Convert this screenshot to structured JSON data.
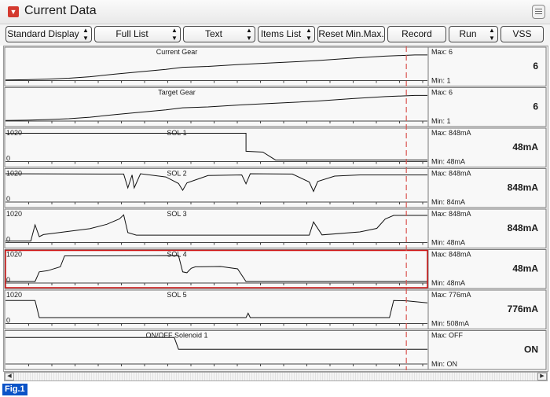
{
  "window": {
    "title": "Current Data"
  },
  "toolbar": {
    "standard_display": "Standard Display",
    "full_list": "Full List",
    "text": "Text",
    "items_list": "Items List",
    "reset_minmax": "Reset Min.Max.",
    "record": "Record",
    "run": "Run",
    "vss": "VSS"
  },
  "graphs": [
    {
      "name": "Current Gear",
      "max": "Max: 6",
      "min": "Min: 1",
      "value": "6",
      "axis_top": "",
      "axis_bottom": ""
    },
    {
      "name": "Target Gear",
      "max": "Max: 6",
      "min": "Min: 1",
      "value": "6",
      "axis_top": "",
      "axis_bottom": ""
    },
    {
      "name": "SOL 1",
      "max": "Max:  848mA",
      "min": "Min:   48mA",
      "value": "48mA",
      "axis_top": "1020",
      "axis_bottom": "0"
    },
    {
      "name": "SOL 2",
      "max": "Max:  848mA",
      "min": "Min:   84mA",
      "value": "848mA",
      "axis_top": "1020",
      "axis_bottom": "0"
    },
    {
      "name": "SOL 3",
      "max": "Max:  848mA",
      "min": "Min:   48mA",
      "value": "848mA",
      "axis_top": "1020",
      "axis_bottom": "0"
    },
    {
      "name": "SOL 4",
      "max": "Max:  848mA",
      "min": "Min:   48mA",
      "value": "48mA",
      "axis_top": "1020",
      "axis_bottom": "0"
    },
    {
      "name": "SOL 5",
      "max": "Max:  776mA",
      "min": "Min:   508mA",
      "value": "776mA",
      "axis_top": "1020",
      "axis_bottom": "0"
    },
    {
      "name": "ON/OFF Solenoid 1",
      "max": "Max: OFF",
      "min": "Min: ON",
      "value": "ON",
      "axis_top": "",
      "axis_bottom": ""
    }
  ],
  "selected_graph": 5,
  "colors": {
    "trace": "#111111",
    "cursor": "#d9534f",
    "selection": "#cc1111",
    "accent": "#d43a2f",
    "fig_badge": "#0a53c7"
  },
  "traces": [
    [
      [
        0,
        0.02
      ],
      [
        0.05,
        0.03
      ],
      [
        0.1,
        0.05
      ],
      [
        0.15,
        0.08
      ],
      [
        0.2,
        0.13
      ],
      [
        0.26,
        0.22
      ],
      [
        0.32,
        0.3
      ],
      [
        0.38,
        0.38
      ],
      [
        0.42,
        0.45
      ],
      [
        0.48,
        0.48
      ],
      [
        0.56,
        0.55
      ],
      [
        0.66,
        0.62
      ],
      [
        0.74,
        0.68
      ],
      [
        0.82,
        0.76
      ],
      [
        0.9,
        0.83
      ],
      [
        0.97,
        0.87
      ],
      [
        1.0,
        0.87
      ]
    ],
    [
      [
        0,
        0.02
      ],
      [
        0.05,
        0.03
      ],
      [
        0.1,
        0.05
      ],
      [
        0.15,
        0.08
      ],
      [
        0.2,
        0.13
      ],
      [
        0.26,
        0.22
      ],
      [
        0.32,
        0.3
      ],
      [
        0.38,
        0.38
      ],
      [
        0.42,
        0.45
      ],
      [
        0.48,
        0.48
      ],
      [
        0.56,
        0.55
      ],
      [
        0.66,
        0.62
      ],
      [
        0.74,
        0.68
      ],
      [
        0.82,
        0.76
      ],
      [
        0.9,
        0.83
      ],
      [
        0.97,
        0.87
      ],
      [
        1.0,
        0.87
      ]
    ],
    [
      [
        0,
        0.96
      ],
      [
        0.57,
        0.96
      ],
      [
        0.57,
        0.35
      ],
      [
        0.61,
        0.32
      ],
      [
        0.64,
        0.05
      ],
      [
        1.0,
        0.05
      ]
    ],
    [
      [
        0,
        0.96
      ],
      [
        0.28,
        0.95
      ],
      [
        0.29,
        0.48
      ],
      [
        0.3,
        0.92
      ],
      [
        0.305,
        0.48
      ],
      [
        0.32,
        0.96
      ],
      [
        0.38,
        0.85
      ],
      [
        0.41,
        0.63
      ],
      [
        0.42,
        0.4
      ],
      [
        0.43,
        0.65
      ],
      [
        0.48,
        0.9
      ],
      [
        0.56,
        0.92
      ],
      [
        0.57,
        0.62
      ],
      [
        0.58,
        0.96
      ],
      [
        0.68,
        0.95
      ],
      [
        0.72,
        0.68
      ],
      [
        0.73,
        0.36
      ],
      [
        0.74,
        0.7
      ],
      [
        0.78,
        0.88
      ],
      [
        0.84,
        0.92
      ],
      [
        0.85,
        0.92
      ],
      [
        1.0,
        0.92
      ]
    ],
    [
      [
        0,
        0.05
      ],
      [
        0.06,
        0.05
      ],
      [
        0.07,
        0.6
      ],
      [
        0.08,
        0.2
      ],
      [
        0.09,
        0.27
      ],
      [
        0.2,
        0.47
      ],
      [
        0.24,
        0.62
      ],
      [
        0.27,
        0.8
      ],
      [
        0.28,
        0.94
      ],
      [
        0.29,
        0.34
      ],
      [
        0.31,
        0.25
      ],
      [
        0.72,
        0.25
      ],
      [
        0.73,
        0.7
      ],
      [
        0.75,
        0.26
      ],
      [
        0.84,
        0.36
      ],
      [
        0.88,
        0.48
      ],
      [
        0.9,
        0.8
      ],
      [
        0.92,
        0.92
      ],
      [
        1.0,
        0.92
      ]
    ],
    [
      [
        0,
        0.05
      ],
      [
        0.07,
        0.05
      ],
      [
        0.08,
        0.38
      ],
      [
        0.1,
        0.42
      ],
      [
        0.13,
        0.55
      ],
      [
        0.14,
        0.92
      ],
      [
        0.2,
        0.92
      ],
      [
        0.41,
        0.93
      ],
      [
        0.42,
        0.38
      ],
      [
        0.43,
        0.35
      ],
      [
        0.44,
        0.5
      ],
      [
        0.45,
        0.55
      ],
      [
        0.51,
        0.56
      ],
      [
        0.55,
        0.48
      ],
      [
        0.57,
        0.05
      ],
      [
        1.0,
        0.05
      ]
    ],
    [
      [
        0,
        0.78
      ],
      [
        0.07,
        0.78
      ],
      [
        0.08,
        0.2
      ],
      [
        0.1,
        0.2
      ],
      [
        0.57,
        0.2
      ],
      [
        0.575,
        0.35
      ],
      [
        0.58,
        0.2
      ],
      [
        0.91,
        0.2
      ],
      [
        0.92,
        0.78
      ],
      [
        0.95,
        0.77
      ],
      [
        1.0,
        0.7
      ]
    ],
    [
      [
        0,
        0.9
      ],
      [
        0.4,
        0.9
      ],
      [
        0.41,
        0.5
      ],
      [
        1.0,
        0.5
      ]
    ]
  ],
  "cursor_position": 0.95
}
